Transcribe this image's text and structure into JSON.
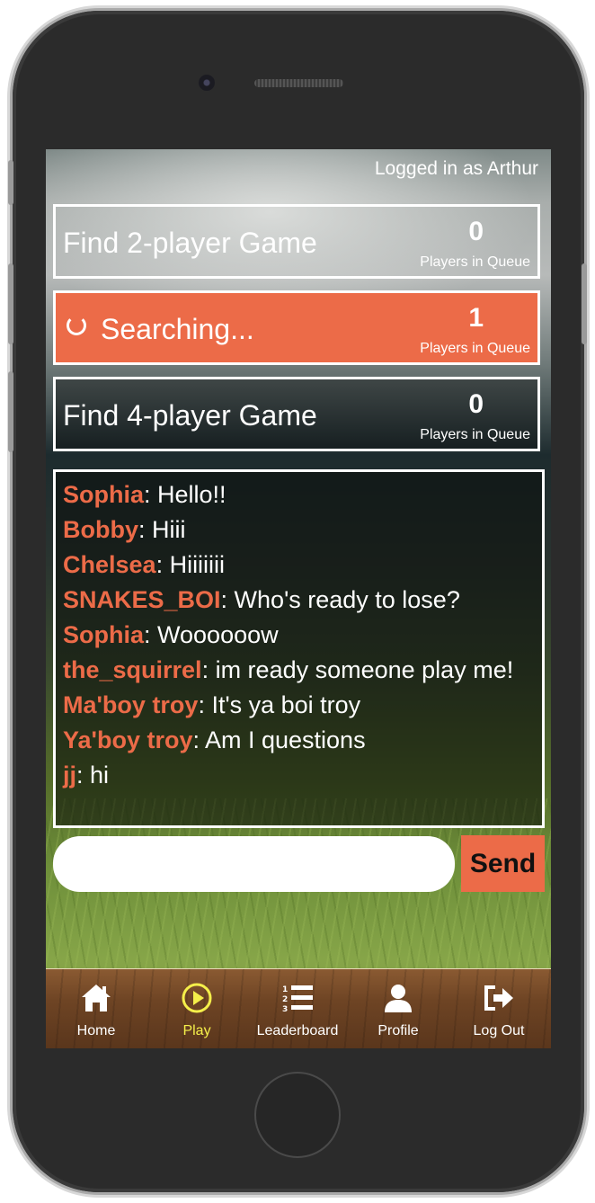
{
  "header": {
    "login_status": "Logged in as Arthur"
  },
  "queues": [
    {
      "title": "Find 2-player Game",
      "count": "0",
      "count_label": "Players in Queue"
    },
    {
      "title": "Searching...",
      "count": "1",
      "count_label": "Players in Queue"
    },
    {
      "title": "Find 4-player Game",
      "count": "0",
      "count_label": "Players in Queue"
    }
  ],
  "chat": {
    "messages": [
      {
        "user": "Sophia",
        "text": ": Hello!!"
      },
      {
        "user": "Bobby",
        "text": ": Hiii"
      },
      {
        "user": "Chelsea",
        "text": ": Hiiiiiii"
      },
      {
        "user": "SNAKES_BOI",
        "text": ": Who's ready to lose?"
      },
      {
        "user": "Sophia",
        "text": ": Woooooow"
      },
      {
        "user": "the_squirrel",
        "text": ": im ready someone play me!"
      },
      {
        "user": "Ma'boy troy",
        "text": ": It's ya boi troy"
      },
      {
        "user": "Ya'boy troy",
        "text": ": Am I questions"
      },
      {
        "user": "jj",
        "text": ": hi"
      }
    ],
    "input_value": "",
    "send_label": "Send"
  },
  "nav": {
    "items": [
      {
        "label": "Home",
        "icon": "home-icon"
      },
      {
        "label": "Play",
        "icon": "play-icon"
      },
      {
        "label": "Leaderboard",
        "icon": "leaderboard-icon"
      },
      {
        "label": "Profile",
        "icon": "profile-icon"
      },
      {
        "label": "Log Out",
        "icon": "logout-icon"
      }
    ],
    "active_index": 1
  },
  "colors": {
    "accent": "#ec6b48",
    "active_nav": "#f5ef4a",
    "text": "#ffffff"
  }
}
